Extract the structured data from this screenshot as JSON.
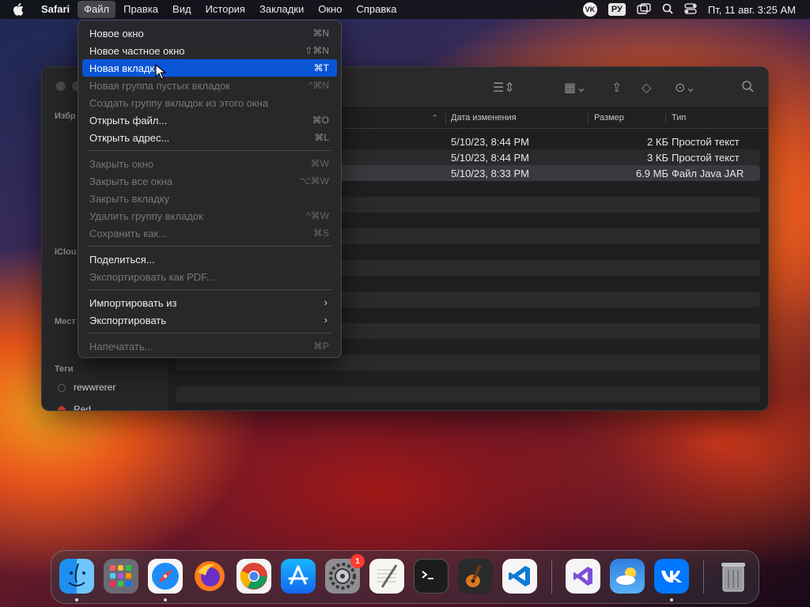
{
  "menubar": {
    "app": "Safari",
    "menus": [
      "Файл",
      "Правка",
      "Вид",
      "История",
      "Закладки",
      "Окно",
      "Справка"
    ],
    "lang": "РУ",
    "vk": "VK",
    "clock": "Пт, 11 авг.  3:25 AM"
  },
  "file_menu": {
    "new_window": {
      "label": "Новое окно",
      "shortcut": "⌘N"
    },
    "new_private": {
      "label": "Новое частное окно",
      "shortcut": "⇧⌘N"
    },
    "new_tab": {
      "label": "Новая вкладка",
      "shortcut": "⌘T"
    },
    "new_tab_group": {
      "label": "Новая группа пустых вкладок",
      "shortcut": "^⌘N"
    },
    "create_group": {
      "label": "Создать группу вкладок из этого окна"
    },
    "open_file": {
      "label": "Открыть файл...",
      "shortcut": "⌘O"
    },
    "open_address": {
      "label": "Открыть адрес...",
      "shortcut": "⌘L"
    },
    "close_window": {
      "label": "Закрыть окно",
      "shortcut": "⌘W"
    },
    "close_all": {
      "label": "Закрыть все окна",
      "shortcut": "⌥⌘W"
    },
    "close_tab": {
      "label": "Закрыть вкладку"
    },
    "delete_group": {
      "label": "Удалить группу вкладок",
      "shortcut": "^⌘W"
    },
    "save_as": {
      "label": "Сохранить как...",
      "shortcut": "⌘S"
    },
    "share": {
      "label": "Поделиться..."
    },
    "export_pdf": {
      "label": "Экспортировать как PDF..."
    },
    "import_from": {
      "label": "Импортировать из"
    },
    "export": {
      "label": "Экспортировать"
    },
    "print": {
      "label": "Напечатать...",
      "shortcut": "⌘P"
    }
  },
  "finder": {
    "sidebar": {
      "favorites_label": "Избр",
      "icloud_label": "iClou",
      "places_label": "Мест",
      "tags_label": "Теги",
      "tags": [
        "rewwrerer",
        "Red"
      ]
    },
    "columns": {
      "date": "Дата изменения",
      "size": "Размер",
      "kind": "Тип"
    },
    "rows": [
      {
        "date": "5/10/23, 8:44 PM",
        "size": "2 КБ",
        "kind": "Простой текст"
      },
      {
        "date": "5/10/23, 8:44 PM",
        "size": "3 КБ",
        "kind": "Простой текст"
      },
      {
        "date": "5/10/23, 8:33 PM",
        "size": "6.9 МБ",
        "kind": "Файл Java JAR"
      }
    ]
  },
  "dock": {
    "settings_badge": "1"
  },
  "colors": {
    "highlight": "#0a55d6",
    "menubar": "#121216"
  }
}
